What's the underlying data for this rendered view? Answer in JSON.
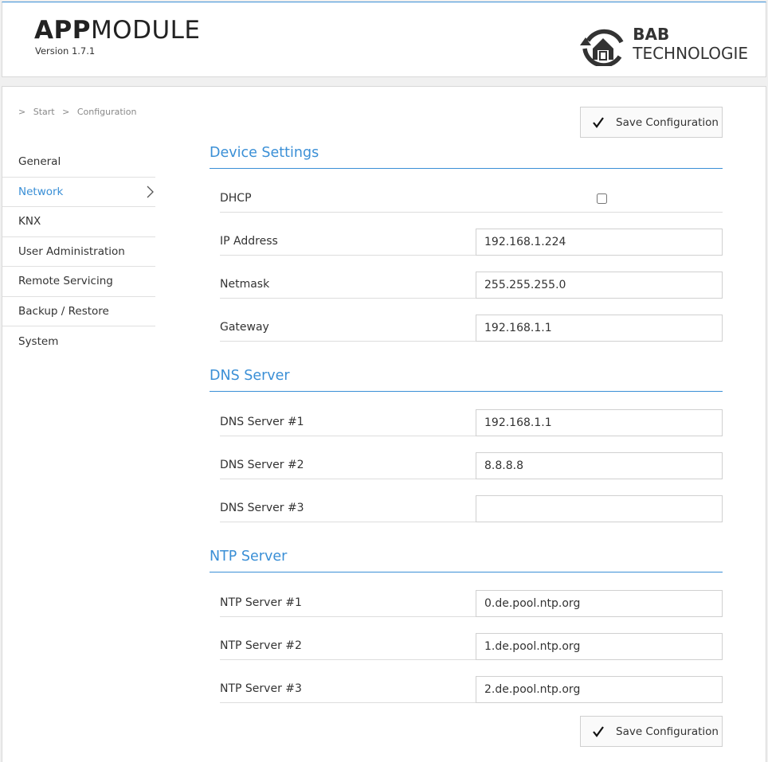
{
  "header": {
    "title_bold": "APP",
    "title_light": "MODULE",
    "version": "Version 1.7.1",
    "brand_line1": "BAB",
    "brand_line2": "TECHNOLOGIE",
    "brand_icon": "house-refresh-logo"
  },
  "breadcrumb": {
    "separator": ">",
    "items": [
      "Start",
      "Configuration"
    ]
  },
  "sidebar": {
    "items": [
      {
        "label": "General"
      },
      {
        "label": "Network",
        "active": true
      },
      {
        "label": "KNX"
      },
      {
        "label": "User Administration"
      },
      {
        "label": "Remote Servicing"
      },
      {
        "label": "Backup / Restore"
      },
      {
        "label": "System"
      }
    ]
  },
  "actions": {
    "save_label": "Save Configuration",
    "save_icon": "checkmark-icon"
  },
  "device_settings": {
    "title": "Device Settings",
    "dhcp_label": "DHCP",
    "dhcp_checked": false,
    "ip_label": "IP Address",
    "ip_value": "192.168.1.224",
    "netmask_label": "Netmask",
    "netmask_value": "255.255.255.0",
    "gateway_label": "Gateway",
    "gateway_value": "192.168.1.1"
  },
  "dns": {
    "title": "DNS Server",
    "servers": [
      {
        "label": "DNS Server #1",
        "value": "192.168.1.1"
      },
      {
        "label": "DNS Server #2",
        "value": "8.8.8.8"
      },
      {
        "label": "DNS Server #3",
        "value": ""
      }
    ]
  },
  "ntp": {
    "title": "NTP Server",
    "servers": [
      {
        "label": "NTP Server #1",
        "value": "0.de.pool.ntp.org"
      },
      {
        "label": "NTP Server #2",
        "value": "1.de.pool.ntp.org"
      },
      {
        "label": "NTP Server #3",
        "value": "2.de.pool.ntp.org"
      }
    ]
  },
  "colors": {
    "accent": "#3a8fd6",
    "text": "#333333",
    "border": "#d8d8d8"
  }
}
